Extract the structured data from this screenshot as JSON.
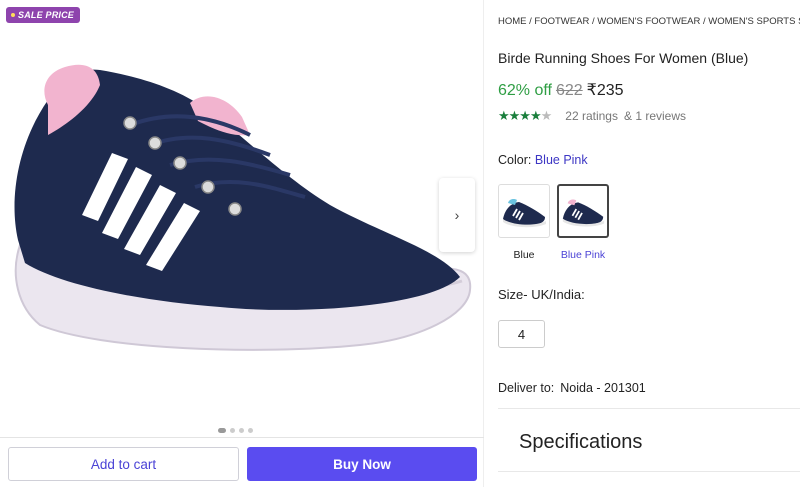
{
  "badge": {
    "label": "SALE PRICE"
  },
  "breadcrumb": {
    "text": "HOME / FOOTWEAR / WOMEN'S FOOTWEAR / WOMEN'S SPORTS SHOES /"
  },
  "product": {
    "title": "Birde Running Shoes For Women (Blue)",
    "discount": "62% off",
    "mrp": "622",
    "price": "₹235",
    "rating": 4,
    "ratings_text": "22 ratings",
    "reviews_text": "& 1 reviews"
  },
  "color": {
    "label": "Color:",
    "selected": "Blue Pink",
    "options": [
      {
        "label": "Blue"
      },
      {
        "label": "Blue Pink"
      }
    ]
  },
  "size": {
    "label": "Size- UK/India:",
    "selected": "4"
  },
  "delivery": {
    "label": "Deliver to:",
    "location": "Noida - 201301"
  },
  "specifications": {
    "title": "Specifications"
  },
  "actions": {
    "add_to_cart": "Add to cart",
    "buy_now": "Buy Now"
  },
  "gallery": {
    "dots": 4,
    "active": 0
  },
  "colors": {
    "accent": "#5a4cf0",
    "discount": "#2f9e44",
    "star": "#1a7f3c",
    "badge": "#8e44ad"
  }
}
